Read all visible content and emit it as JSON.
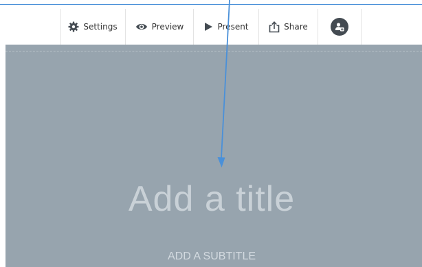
{
  "toolbar": {
    "items": [
      {
        "label": "Settings",
        "icon": "gear-icon"
      },
      {
        "label": "Preview",
        "icon": "eye-icon"
      },
      {
        "label": "Present",
        "icon": "play-icon"
      },
      {
        "label": "Share",
        "icon": "share-icon"
      }
    ],
    "profile_icon": "user-add-icon"
  },
  "slide": {
    "title_placeholder": "Add a title",
    "subtitle_placeholder": "ADD A SUBTITLE"
  },
  "colors": {
    "canvas": "#97a4ae",
    "accent_line": "#4a90d9",
    "annotation_arrow": "#4a90d9"
  }
}
